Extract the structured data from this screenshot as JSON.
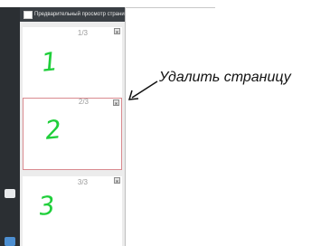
{
  "window": {
    "title": "Предварительный просмотр страни"
  },
  "pages": [
    {
      "number": "1/3",
      "content": "1",
      "selected": false
    },
    {
      "number": "2/3",
      "content": "2",
      "selected": true
    },
    {
      "number": "3/3",
      "content": "3",
      "selected": false
    }
  ],
  "callout": {
    "text": "Удалить страницу"
  },
  "colors": {
    "sidebar": "#2b2f33",
    "selected_border": "#d98a8f",
    "digit": "#1fcf3a"
  }
}
